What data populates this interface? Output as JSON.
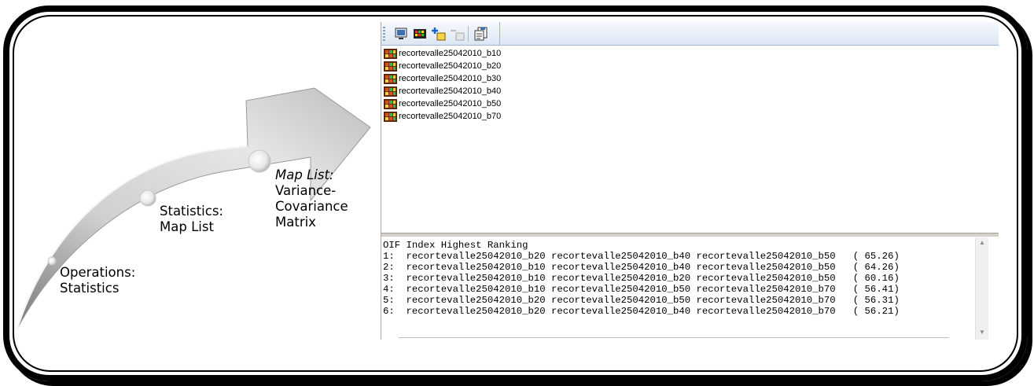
{
  "steps": [
    {
      "title": "Operations:",
      "subtitle": "Statistics"
    },
    {
      "title": "Statistics:",
      "subtitle": "Map List"
    },
    {
      "title": "Map List:",
      "line2": "Variance-",
      "line3": "Covariance",
      "line4": "Matrix"
    }
  ],
  "toolbar": {
    "icons": [
      "display-icon",
      "map-colors-icon",
      "add-map-icon",
      "remove-map-icon",
      "properties-icon"
    ]
  },
  "maplist": {
    "items": [
      "recortevalle25042010_b10",
      "recortevalle25042010_b20",
      "recortevalle25042010_b30",
      "recortevalle25042010_b40",
      "recortevalle25042010_b50",
      "recortevalle25042010_b70"
    ]
  },
  "output": {
    "header": "OIF Index Highest Ranking",
    "rows": [
      {
        "rank": "1:",
        "bands": [
          "recortevalle25042010_b20",
          "recortevalle25042010_b40",
          "recortevalle25042010_b50"
        ],
        "value": "65.26"
      },
      {
        "rank": "2:",
        "bands": [
          "recortevalle25042010_b10",
          "recortevalle25042010_b40",
          "recortevalle25042010_b50"
        ],
        "value": "64.26"
      },
      {
        "rank": "3:",
        "bands": [
          "recortevalle25042010_b10",
          "recortevalle25042010_b20",
          "recortevalle25042010_b50"
        ],
        "value": "60.16"
      },
      {
        "rank": "4:",
        "bands": [
          "recortevalle25042010_b10",
          "recortevalle25042010_b50",
          "recortevalle25042010_b70"
        ],
        "value": "56.41"
      },
      {
        "rank": "5:",
        "bands": [
          "recortevalle25042010_b20",
          "recortevalle25042010_b50",
          "recortevalle25042010_b70"
        ],
        "value": "56.31"
      },
      {
        "rank": "6:",
        "bands": [
          "recortevalle25042010_b20",
          "recortevalle25042010_b40",
          "recortevalle25042010_b70"
        ],
        "value": "56.21"
      }
    ]
  }
}
